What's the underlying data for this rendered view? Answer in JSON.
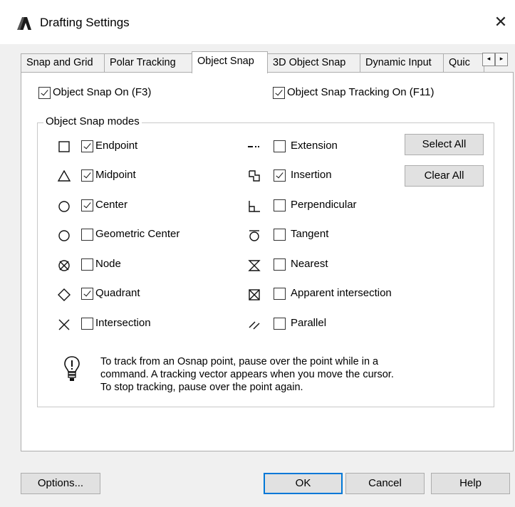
{
  "window": {
    "title": "Drafting Settings",
    "close_glyph": "✕"
  },
  "tabs": [
    {
      "label": "Snap and Grid",
      "active": false
    },
    {
      "label": "Polar Tracking",
      "active": false
    },
    {
      "label": "Object Snap",
      "active": true
    },
    {
      "label": "3D Object Snap",
      "active": false
    },
    {
      "label": "Dynamic Input",
      "active": false
    },
    {
      "label": "Quic",
      "active": false
    }
  ],
  "tab_scroll": {
    "left": "◂",
    "right": "▸"
  },
  "object_snap_on": {
    "label": "Object Snap On (F3)",
    "checked": true
  },
  "object_snap_tracking": {
    "label": "Object Snap Tracking On (F11)",
    "checked": true
  },
  "modes_group": {
    "title": "Object Snap modes"
  },
  "modes_left": [
    {
      "label": "Endpoint",
      "checked": true,
      "icon": "endpoint-square-icon"
    },
    {
      "label": "Midpoint",
      "checked": true,
      "icon": "midpoint-triangle-icon"
    },
    {
      "label": "Center",
      "checked": true,
      "icon": "center-circle-icon"
    },
    {
      "label": "Geometric Center",
      "checked": false,
      "icon": "geometric-center-circle-icon"
    },
    {
      "label": "Node",
      "checked": false,
      "icon": "node-icon"
    },
    {
      "label": "Quadrant",
      "checked": true,
      "icon": "quadrant-diamond-icon"
    },
    {
      "label": "Intersection",
      "checked": false,
      "icon": "intersection-x-icon"
    }
  ],
  "modes_right": [
    {
      "label": "Extension",
      "checked": false,
      "icon": "extension-icon"
    },
    {
      "label": "Insertion",
      "checked": true,
      "icon": "insertion-icon"
    },
    {
      "label": "Perpendicular",
      "checked": false,
      "icon": "perpendicular-icon"
    },
    {
      "label": "Tangent",
      "checked": false,
      "icon": "tangent-icon"
    },
    {
      "label": "Nearest",
      "checked": false,
      "icon": "nearest-hourglass-icon"
    },
    {
      "label": "Apparent intersection",
      "checked": false,
      "icon": "apparent-intersection-icon"
    },
    {
      "label": "Parallel",
      "checked": false,
      "icon": "parallel-icon"
    }
  ],
  "buttons": {
    "select_all": "Select All",
    "clear_all": "Clear All",
    "options": "Options...",
    "ok": "OK",
    "cancel": "Cancel",
    "help": "Help"
  },
  "info": {
    "icon": "lightbulb-icon",
    "lines": [
      "To track from an Osnap point, pause over the point while in a",
      "command.  A tracking vector appears when you move the cursor.",
      "To stop tracking, pause over the point again."
    ]
  }
}
